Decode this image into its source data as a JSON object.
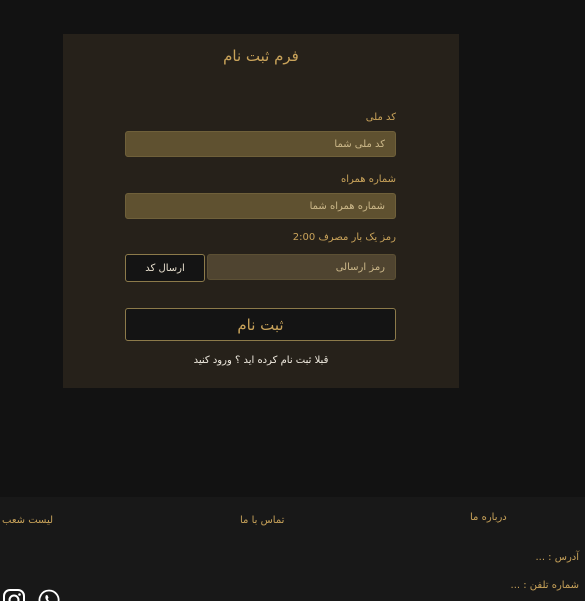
{
  "form": {
    "title": "فرم ثبت نام",
    "national_code": {
      "label": "کد ملی",
      "placeholder": "کد ملی شما",
      "value": ""
    },
    "phone": {
      "label": "شماره همراه",
      "placeholder": "شماره همراه شما",
      "value": ""
    },
    "otp": {
      "label": "رمز یک بار مصرف 2:00",
      "placeholder": "رمز ارسالی",
      "value": ""
    },
    "send_code_label": "ارسال کد",
    "submit_label": "ثبت نام",
    "login_prompt": "قبلا ثبت نام کرده اید ؟ ورود کنید"
  },
  "footer": {
    "branches_label": "لیست شعب",
    "contact_label": "تماس با ما",
    "about_label": "درباره ما",
    "address": "آدرس : ...",
    "phone": "شماره تلفن : ...",
    "social_icons": [
      "instagram-icon",
      "whatsapp-icon"
    ]
  },
  "colors": {
    "background": "#121212",
    "card": "#26211a",
    "accent": "#c9a35a",
    "field": "#5f5130"
  }
}
